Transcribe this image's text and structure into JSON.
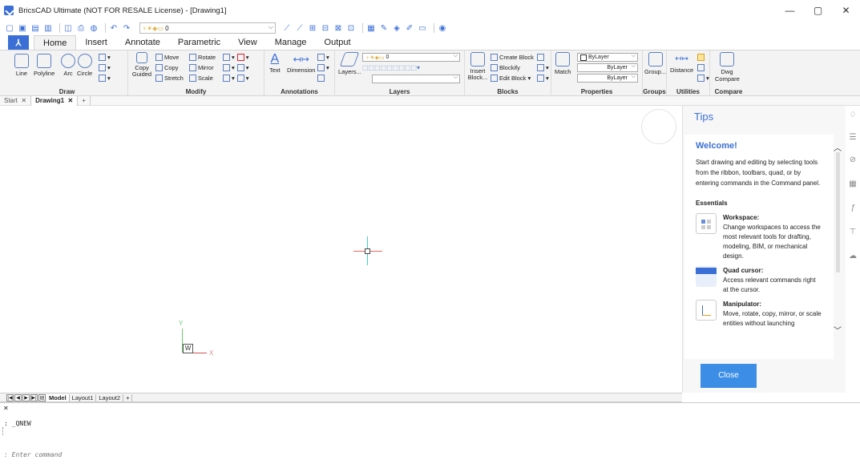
{
  "window": {
    "title": "BricsCAD Ultimate (NOT FOR RESALE License) - [Drawing1]",
    "controls": [
      "—",
      "▢",
      "✕"
    ]
  },
  "qat": {
    "layer_value": "0"
  },
  "ribbon_tabs": [
    "Home",
    "Insert",
    "Annotate",
    "Parametric",
    "View",
    "Manage",
    "Output"
  ],
  "draw": {
    "title": "Draw",
    "line": "Line",
    "polyline": "Polyline",
    "arc": "Arc",
    "circle": "Circle"
  },
  "modify": {
    "title": "Modify",
    "move": "Move",
    "copy": "Copy",
    "stretch": "Stretch",
    "rotate": "Rotate",
    "mirror": "Mirror",
    "scale": "Scale",
    "copy_guided": "Copy Guided"
  },
  "annotations": {
    "title": "Annotations",
    "text": "Text",
    "dimension": "Dimension"
  },
  "layers": {
    "title": "Layers",
    "layers_btn": "Layers...",
    "current": "0"
  },
  "blocks": {
    "title": "Blocks",
    "insert": "Insert Block...",
    "create": "Create Block",
    "blockify": "Blockify",
    "edit": "Edit Block"
  },
  "properties": {
    "title": "Properties",
    "match": "Match",
    "color": "ByLayer",
    "linetype": "ByLayer",
    "lineweight": "ByLayer"
  },
  "groups": {
    "title": "Groups",
    "group": "Group..."
  },
  "utilities": {
    "title": "Utilities",
    "distance": "Distance"
  },
  "compare": {
    "title": "Compare",
    "dwg_compare": "Dwg Compare"
  },
  "doc_tabs": {
    "start": "Start",
    "drawing": "Drawing1",
    "close": "✕",
    "add": "+"
  },
  "ucs": {
    "x": "X",
    "y": "Y",
    "w": "W"
  },
  "tips": {
    "title": "Tips",
    "welcome": "Welcome!",
    "intro": "Start drawing and editing by selecting tools from the ribbon, toolbars, quad, or by entering commands in the Command panel.",
    "essentials": "Essentials",
    "items": [
      {
        "title": "Workspace:",
        "text": "Change workspaces to access the most relevant tools for drafting, modeling, BIM, or mechanical design."
      },
      {
        "title": "Quad cursor:",
        "text": "Access relevant commands right at the cursor."
      },
      {
        "title": "Manipulator:",
        "text": "Move, rotate, copy, mirror, or scale entities without launching"
      }
    ],
    "close": "Close"
  },
  "layout_tabs": [
    "Model",
    "Layout1",
    "Layout2",
    "+"
  ],
  "command": {
    "history": ": _QNEW",
    "placeholder": ": Enter command"
  },
  "colors": {
    "accent": "#3b6fd6",
    "close_button": "#3b8de6"
  }
}
